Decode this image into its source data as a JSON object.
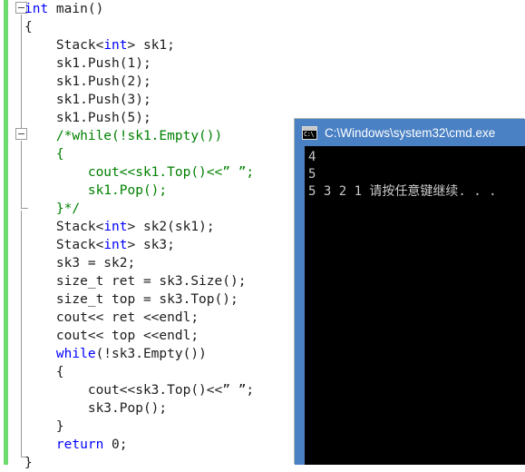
{
  "editor": {
    "name": "code-editor",
    "language": "cpp",
    "colors": {
      "keyword": "#0000ff",
      "comment": "#008000",
      "plain": "#1c1c1c",
      "change_bar": "#6ddc6d",
      "background": "#ffffff"
    },
    "lines": [
      [
        {
          "t": "int",
          "c": "kw"
        },
        {
          "t": " main()",
          "c": "plain"
        }
      ],
      [
        {
          "t": "{",
          "c": "plain"
        }
      ],
      [
        {
          "t": "    Stack<",
          "c": "plain"
        },
        {
          "t": "int",
          "c": "kw"
        },
        {
          "t": "> sk1;",
          "c": "plain"
        }
      ],
      [
        {
          "t": "    sk1.Push(1);",
          "c": "plain"
        }
      ],
      [
        {
          "t": "    sk1.Push(2);",
          "c": "plain"
        }
      ],
      [
        {
          "t": "    sk1.Push(3);",
          "c": "plain"
        }
      ],
      [
        {
          "t": "    sk1.Push(5);",
          "c": "plain"
        }
      ],
      [
        {
          "t": "    /*while(!sk1.Empty())",
          "c": "cmt"
        }
      ],
      [
        {
          "t": "    {",
          "c": "cmt"
        }
      ],
      [
        {
          "t": "        cout<<sk1.Top()<<” ”;",
          "c": "cmt"
        }
      ],
      [
        {
          "t": "        sk1.Pop();",
          "c": "cmt"
        }
      ],
      [
        {
          "t": "    }*/",
          "c": "cmt"
        }
      ],
      [
        {
          "t": "    Stack<",
          "c": "plain"
        },
        {
          "t": "int",
          "c": "kw"
        },
        {
          "t": "> sk2(sk1);",
          "c": "plain"
        }
      ],
      [
        {
          "t": "    Stack<",
          "c": "plain"
        },
        {
          "t": "int",
          "c": "kw"
        },
        {
          "t": "> sk3;",
          "c": "plain"
        }
      ],
      [
        {
          "t": "    sk3 = sk2;",
          "c": "plain"
        }
      ],
      [
        {
          "t": "    size_t ret = sk3.Size();",
          "c": "plain"
        }
      ],
      [
        {
          "t": "    size_t top = sk3.Top();",
          "c": "plain"
        }
      ],
      [
        {
          "t": "    cout<< ret <<endl;",
          "c": "plain"
        }
      ],
      [
        {
          "t": "    cout<< top <<endl;",
          "c": "plain"
        }
      ],
      [
        {
          "t": "    ",
          "c": "plain"
        },
        {
          "t": "while",
          "c": "kw"
        },
        {
          "t": "(!sk3.Empty())",
          "c": "plain"
        }
      ],
      [
        {
          "t": "    {",
          "c": "plain"
        }
      ],
      [
        {
          "t": "        cout<<sk3.Top()<<” ”;",
          "c": "plain"
        }
      ],
      [
        {
          "t": "        sk3.Pop();",
          "c": "plain"
        }
      ],
      [
        {
          "t": "    }",
          "c": "plain"
        }
      ],
      [
        {
          "t": "    ",
          "c": "plain"
        },
        {
          "t": "return",
          "c": "kw"
        },
        {
          "t": " 0;",
          "c": "plain"
        }
      ],
      [
        {
          "t": "}",
          "c": "plain"
        }
      ]
    ]
  },
  "console": {
    "title": "C:\\Windows\\system32\\cmd.exe",
    "icon_name": "console-window-icon",
    "icon_prompt": "C:\\",
    "frame_color": "#4a81c4",
    "background": "#000000",
    "text_color": "#c8c8c8",
    "output": "4\n5\n5 3 2 1 请按任意键继续. . ."
  }
}
